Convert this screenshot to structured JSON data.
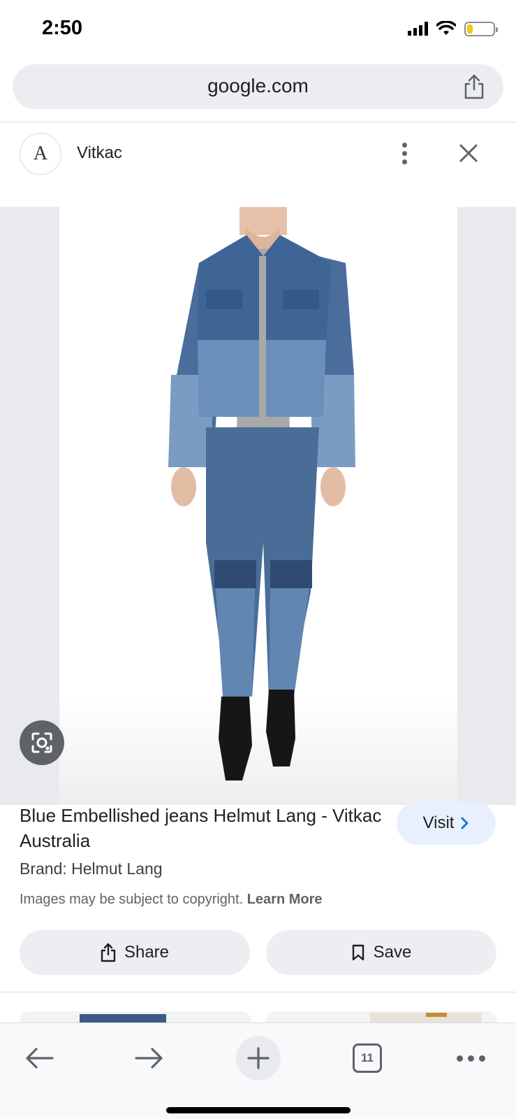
{
  "status_bar": {
    "time": "2:50"
  },
  "url_bar": {
    "url": "google.com",
    "share_icon": "share-icon"
  },
  "source": {
    "logo_text": "A",
    "name": "Vitkac"
  },
  "header_icons": {
    "more": "more-vert-icon",
    "close": "close-icon"
  },
  "image": {
    "description_icon": "lens-icon"
  },
  "product": {
    "title": "Blue Embellished jeans Helmut Lang - Vitkac Australia",
    "brand": "Brand: Helmut Lang",
    "copyright": "Images may be subject to copyright.",
    "learn_more": "Learn More"
  },
  "visit_button": {
    "label": "Visit"
  },
  "actions": {
    "share_label": "Share",
    "save_label": "Save"
  },
  "toolbar": {
    "tab_count": "11"
  },
  "colors": {
    "visit_bg": "#e8f0fe",
    "button_bg": "#eceef1",
    "battery": "#f5c518"
  }
}
